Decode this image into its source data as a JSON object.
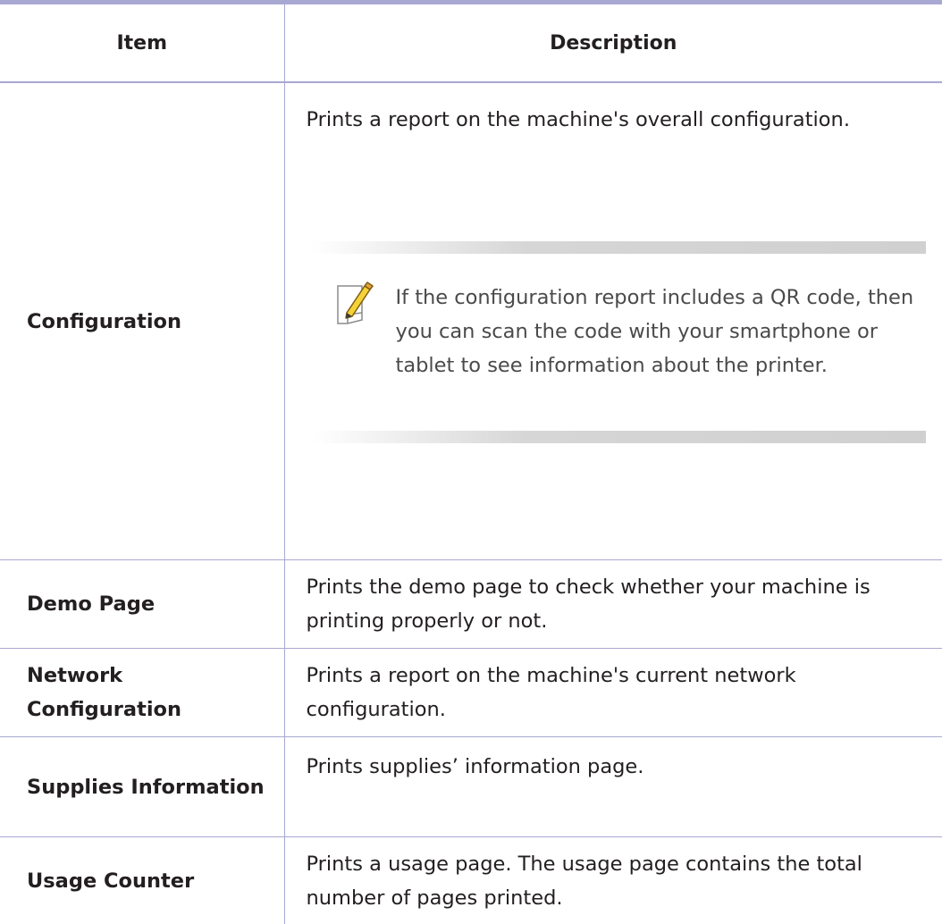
{
  "table": {
    "headers": {
      "item": "Item",
      "description": "Description"
    },
    "rows": [
      {
        "item": "Configuration",
        "description": "Prints a report on the machine's overall configuration.",
        "note": {
          "icon": "note-pencil-icon",
          "text": "If the configuration report includes a QR code, then you can scan the code with your smartphone or tablet to see information about the printer."
        }
      },
      {
        "item": "Demo Page",
        "description": "Prints the demo page to check whether your machine is printing properly or not."
      },
      {
        "item": "Network Configuration",
        "description": "Prints a report on the machine's current network configuration."
      },
      {
        "item": "Supplies Information",
        "description": "Prints supplies’ information page."
      },
      {
        "item": "Usage Counter",
        "description": "Prints a usage page. The usage page contains the total number of pages printed."
      }
    ]
  },
  "colors": {
    "rule": "#a9a8d3",
    "text": "#231f20",
    "note_text": "#4a4a4a",
    "note_bar": "#d0d0d0"
  }
}
